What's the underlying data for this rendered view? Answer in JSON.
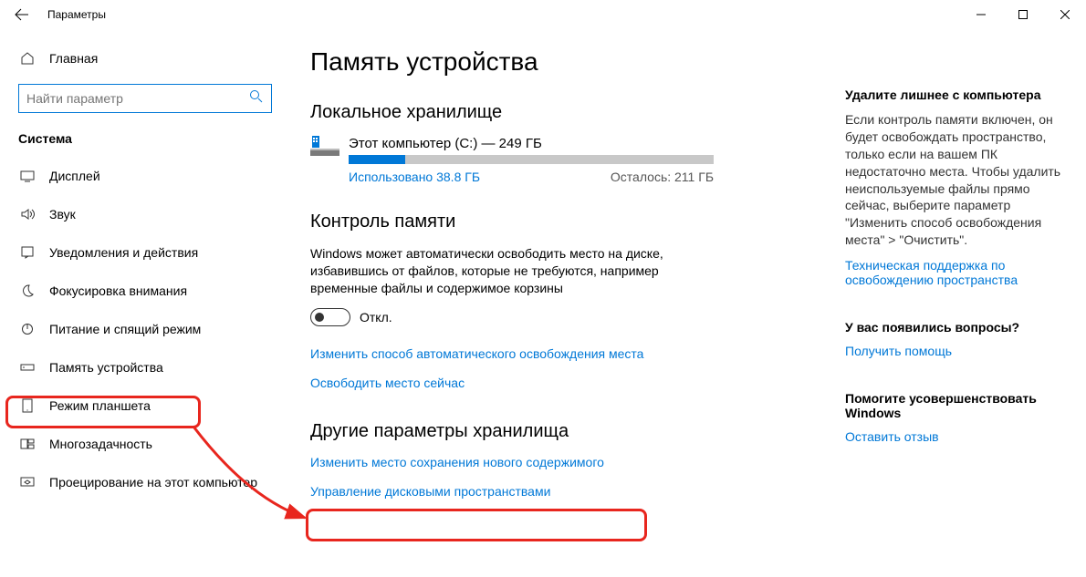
{
  "window": {
    "title": "Параметры"
  },
  "sidebar": {
    "home": "Главная",
    "search_placeholder": "Найти параметр",
    "group": "Система",
    "items": [
      {
        "label": "Дисплей"
      },
      {
        "label": "Звук"
      },
      {
        "label": "Уведомления и действия"
      },
      {
        "label": "Фокусировка внимания"
      },
      {
        "label": "Питание и спящий режим"
      },
      {
        "label": "Память устройства"
      },
      {
        "label": "Режим планшета"
      },
      {
        "label": "Многозадачность"
      },
      {
        "label": "Проецирование на этот компьютер"
      }
    ]
  },
  "main": {
    "title": "Память устройства",
    "local_storage_header": "Локальное хранилище",
    "drive": {
      "label": "Этот компьютер (C:) — 249 ГБ",
      "used": "Использовано 38.8 ГБ",
      "free": "Осталось: 211 ГБ",
      "percent": 15.6
    },
    "sense_header": "Контроль памяти",
    "sense_desc": "Windows может автоматически освободить место на диске, избавившись от файлов, которые не требуются, например временные файлы и содержимое корзины",
    "toggle_state": "Откл.",
    "link_change_free": "Изменить способ автоматического освобождения места",
    "link_free_now": "Освободить место сейчас",
    "more_header": "Другие параметры хранилища",
    "link_change_save": "Изменить место сохранения нового содержимого",
    "link_manage_spaces": "Управление дисковыми пространствами"
  },
  "right": {
    "r1_title": "Удалите лишнее с компьютера",
    "r1_text": "Если контроль памяти включен, он будет освобождать пространство, только если на вашем ПК недостаточно места. Чтобы удалить неиспользуемые файлы прямо сейчас, выберите параметр \"Изменить способ освобождения места\" > \"Очистить\".",
    "r1_link": "Техническая поддержка по освобождению пространства",
    "r2_title": "У вас появились вопросы?",
    "r2_link": "Получить помощь",
    "r3_title": "Помогите усовершенствовать Windows",
    "r3_link": "Оставить отзыв"
  }
}
